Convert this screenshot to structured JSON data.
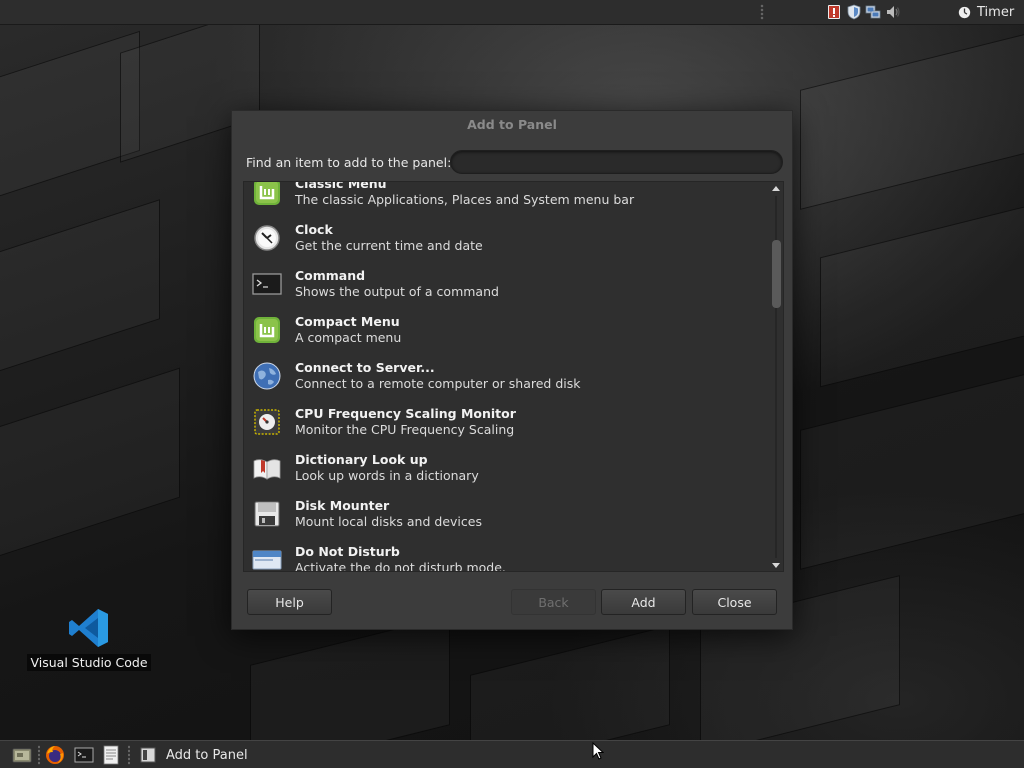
{
  "top_panel": {
    "timer_label": "Timer"
  },
  "desktop": {
    "icons": [
      {
        "label": "Visual Studio Code"
      }
    ]
  },
  "dialog": {
    "title": "Add to Panel",
    "find_label": "Find an item to add to the panel:",
    "search_value": "",
    "items": [
      {
        "name": "Classic Menu",
        "desc": "The classic Applications, Places and System menu bar",
        "icon": "mint-menu-icon"
      },
      {
        "name": "Clock",
        "desc": "Get the current time and date",
        "icon": "clock-icon"
      },
      {
        "name": "Command",
        "desc": "Shows the output of a command",
        "icon": "terminal-icon"
      },
      {
        "name": "Compact Menu",
        "desc": "A compact menu",
        "icon": "mint-menu-icon"
      },
      {
        "name": "Connect to Server...",
        "desc": "Connect to a remote computer or shared disk",
        "icon": "globe-icon"
      },
      {
        "name": "CPU Frequency Scaling Monitor",
        "desc": "Monitor the CPU Frequency Scaling",
        "icon": "cpu-gauge-icon"
      },
      {
        "name": "Dictionary Look up",
        "desc": "Look up words in a dictionary",
        "icon": "book-icon"
      },
      {
        "name": "Disk Mounter",
        "desc": "Mount local disks and devices",
        "icon": "floppy-icon"
      },
      {
        "name": "Do Not Disturb",
        "desc": "Activate the do not disturb mode.",
        "icon": "notification-icon"
      }
    ],
    "buttons": {
      "help": "Help",
      "back": "Back",
      "add": "Add",
      "close": "Close"
    }
  },
  "taskbar": {
    "task_label": "Add to Panel"
  },
  "colors": {
    "mint_green": "#8bc34a",
    "vscode_blue": "#2a9ae3",
    "dialog_bg": "#3c3c3c",
    "list_bg": "#2f2f2f"
  }
}
